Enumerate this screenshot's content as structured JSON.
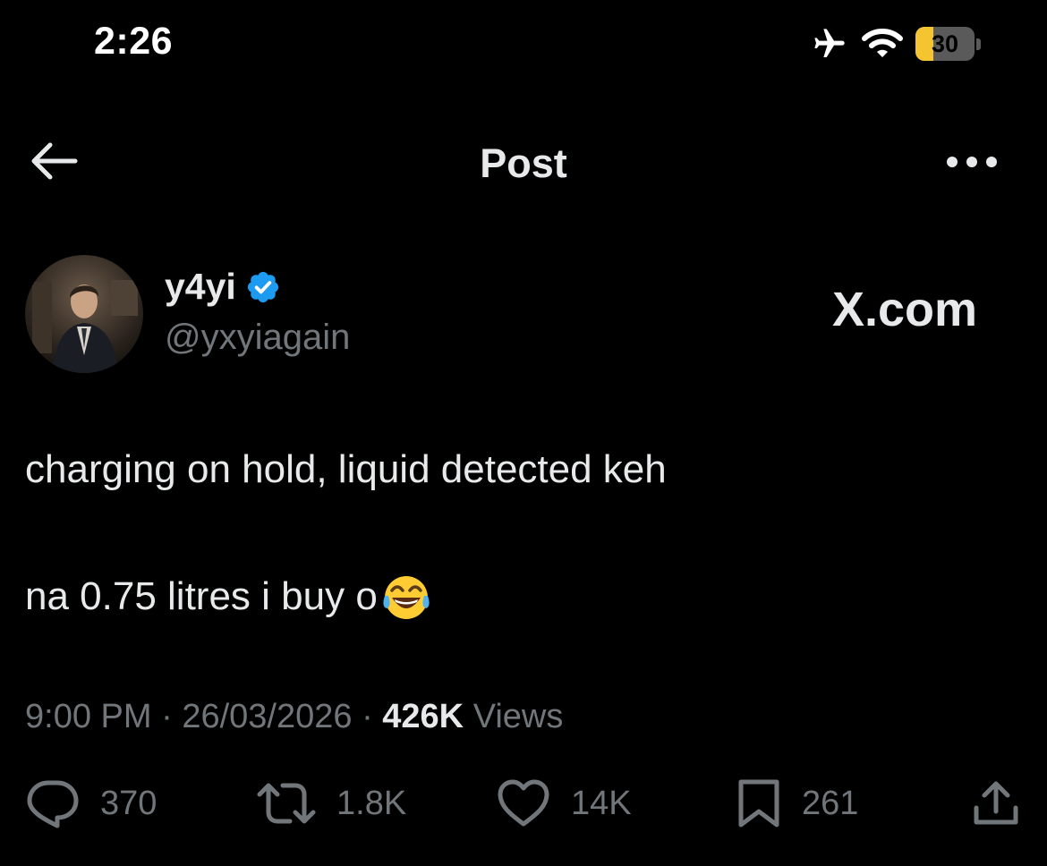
{
  "status_bar": {
    "time": "2:26",
    "battery_percent": "30",
    "battery_level": 0.3,
    "battery_color": "#f4c431"
  },
  "nav": {
    "title": "Post"
  },
  "author": {
    "name": "y4yi",
    "handle": "@yxyiagain",
    "verified_color": "#1d9bf0"
  },
  "watermark": "X.com",
  "tweet": {
    "line1": "charging on hold, liquid detected keh",
    "line2": "na 0.75 litres i buy o",
    "emoji": "face-with-tears-of-joy"
  },
  "meta": {
    "time": "9:00 PM",
    "sep1": "·",
    "date": "26/03/2026",
    "sep2": "·",
    "views_count": "426K",
    "views_label": "Views"
  },
  "actions": {
    "replies": "370",
    "reposts": "1.8K",
    "likes": "14K",
    "bookmarks": "261"
  },
  "colors": {
    "background": "#000000",
    "text": "#e7e9ea",
    "secondary": "#71767b"
  }
}
